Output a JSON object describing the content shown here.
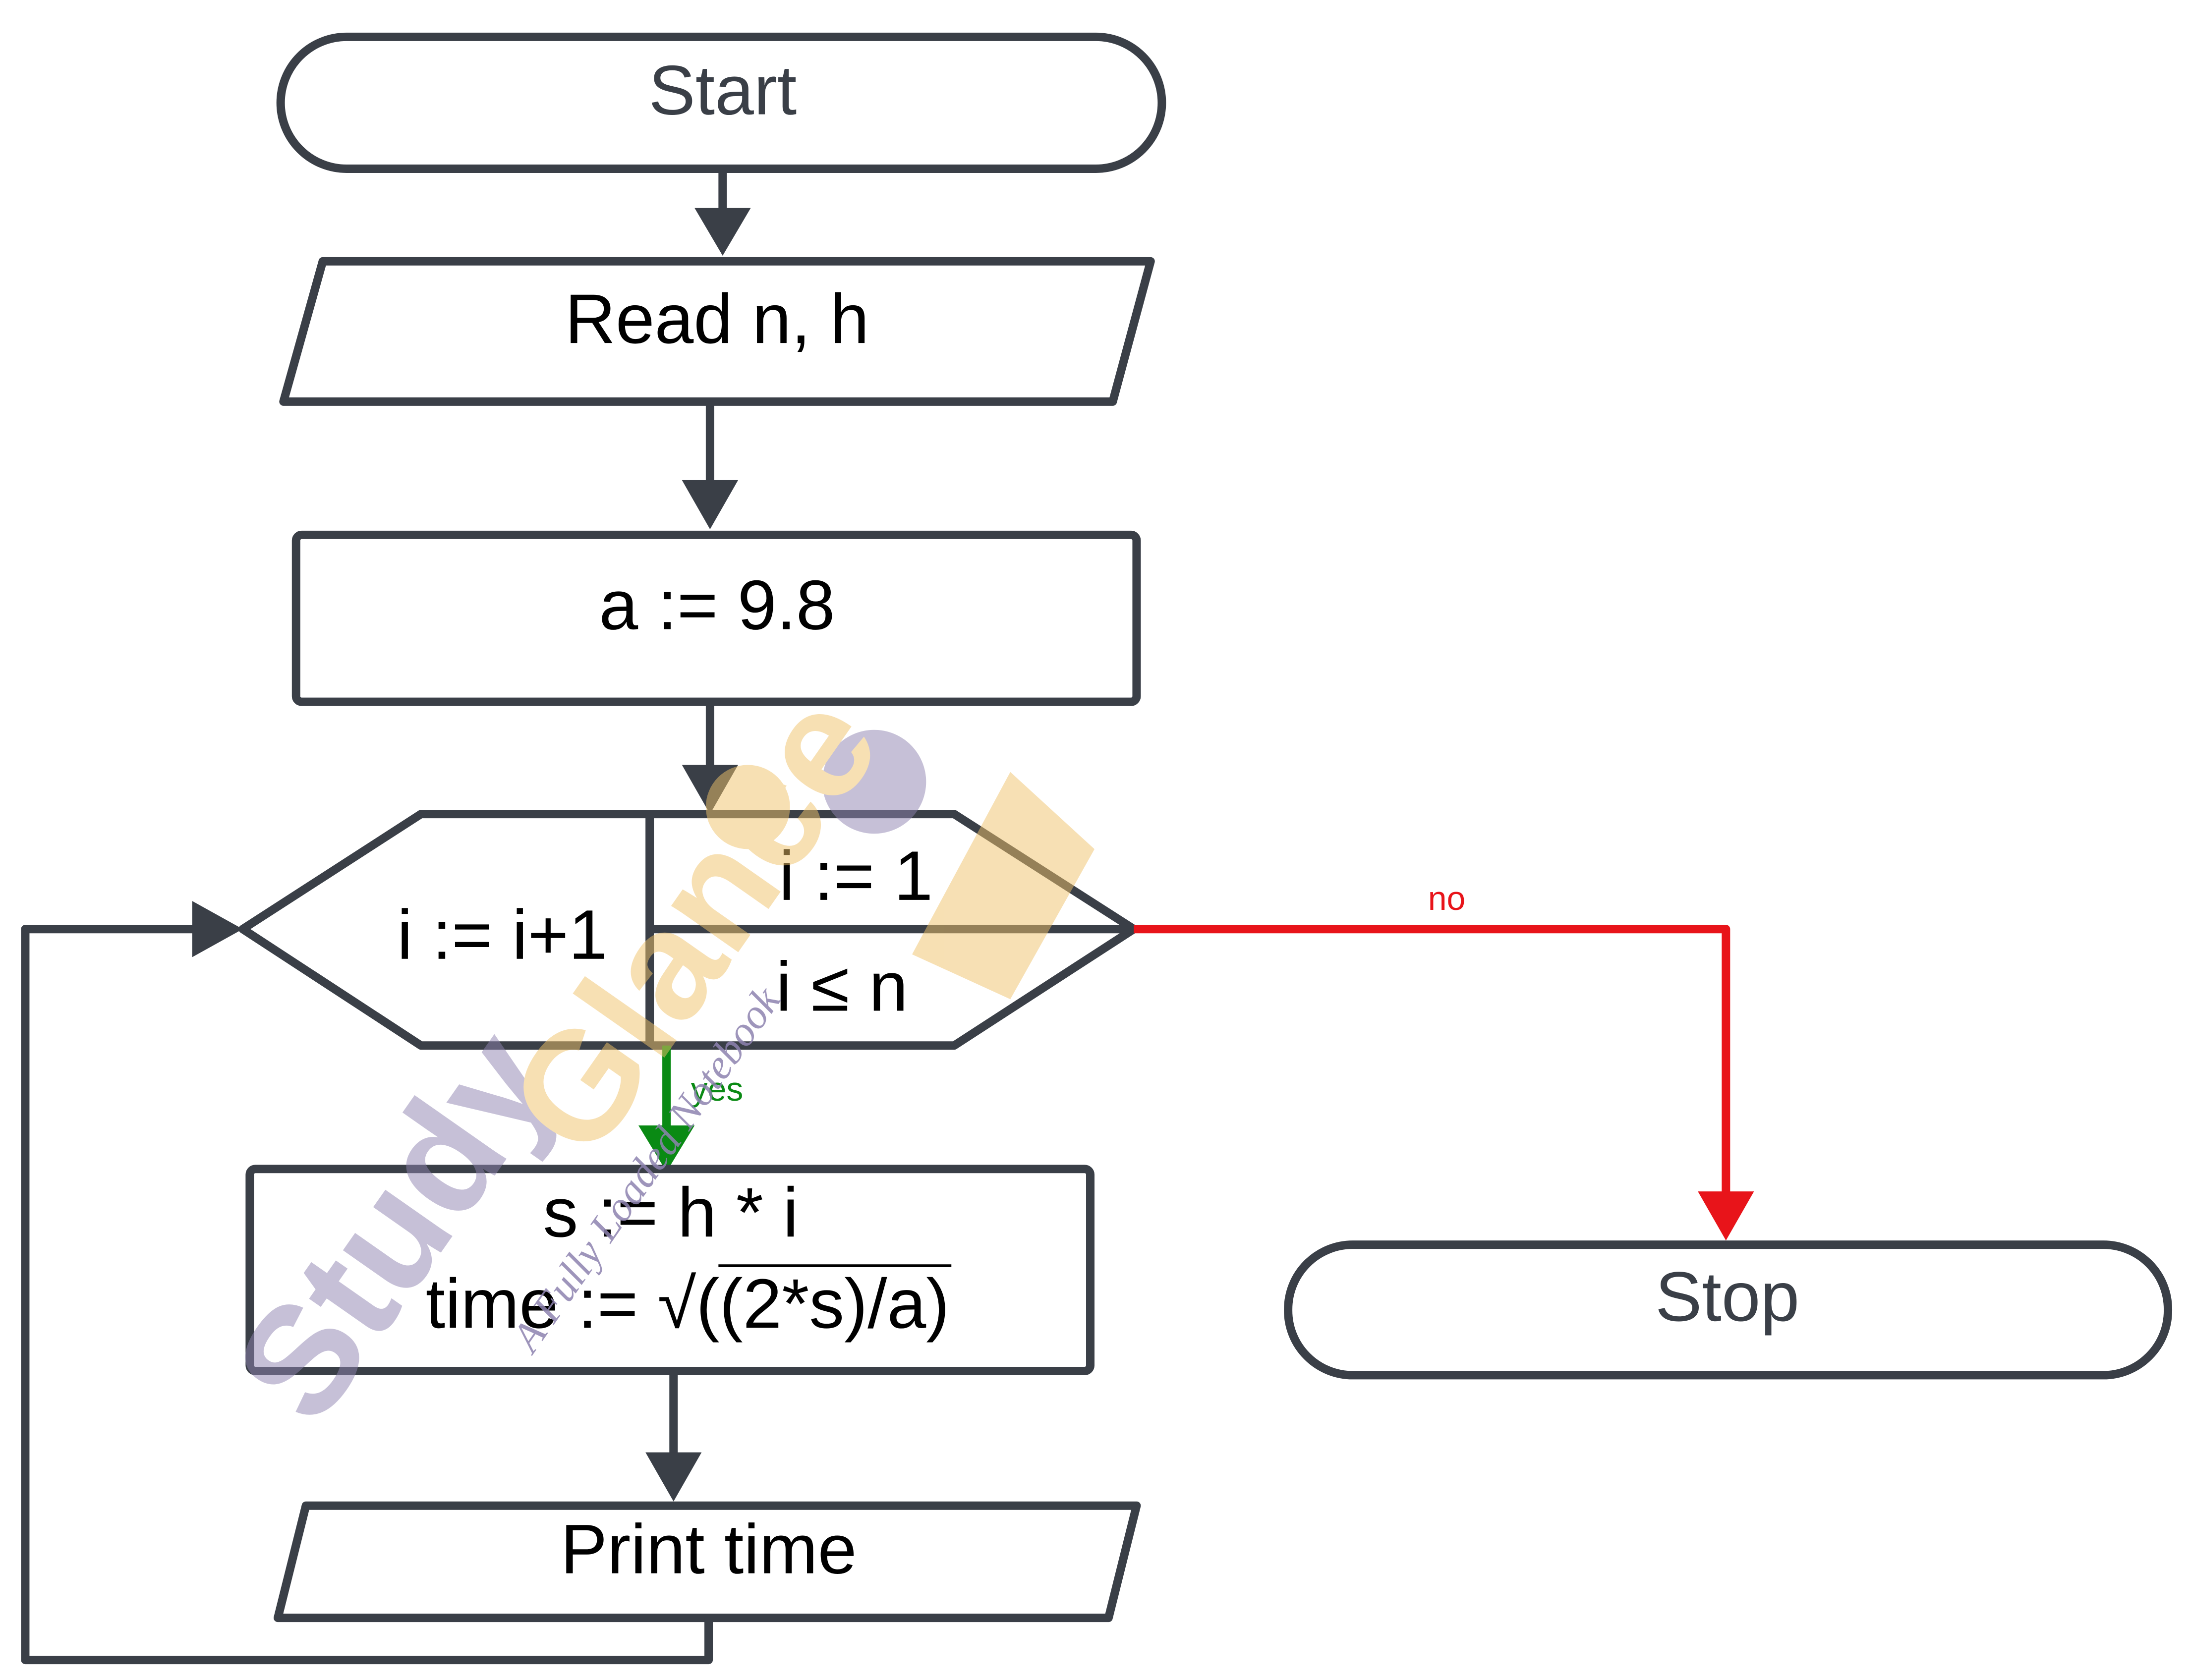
{
  "flowchart": {
    "start": "Start",
    "read": "Read n, h",
    "init": "a := 9.8",
    "loop": {
      "increment": "i := i+1",
      "init": "i := 1",
      "condition": "i ≤ n"
    },
    "yes_label": "yes",
    "no_label": "no",
    "compute": {
      "line1": "s := h * i",
      "line2": "time := √((2*s)/a)"
    },
    "print": "Print time",
    "stop": "Stop"
  },
  "watermark": {
    "brand": "Study Glance",
    "tagline": "A Fully Loaded Notebook"
  },
  "colors": {
    "stroke": "#3a3f47",
    "yes": "#0a8a14",
    "no": "#e8141a"
  }
}
